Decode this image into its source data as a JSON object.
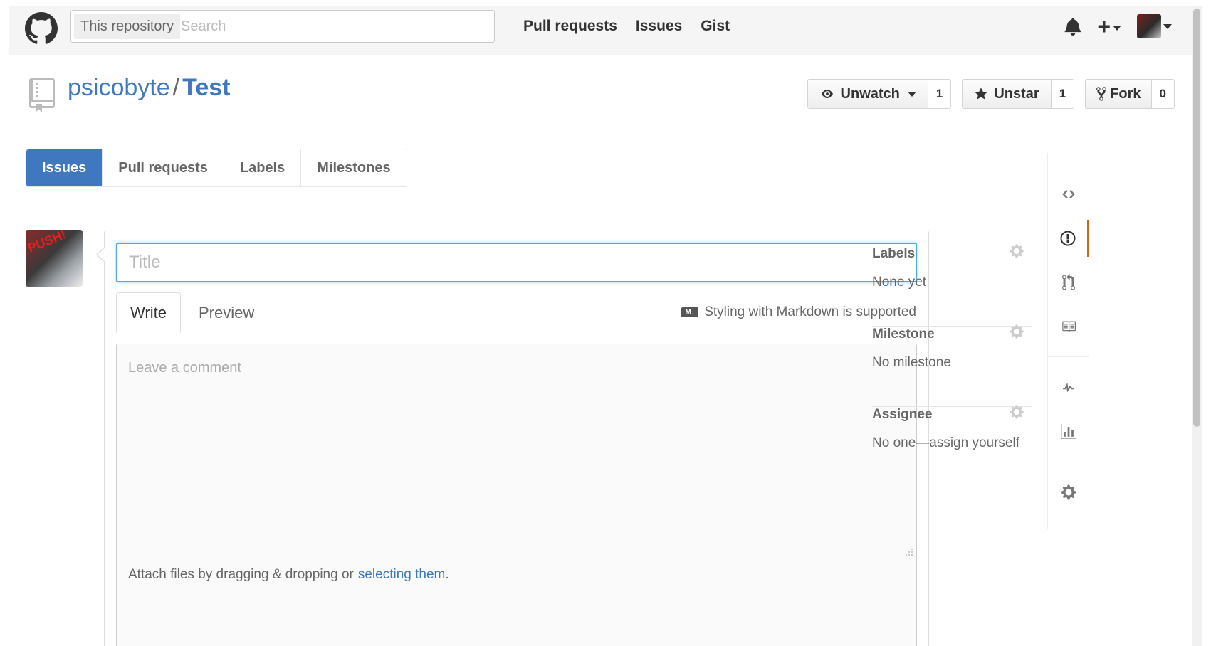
{
  "header": {
    "search_scope": "This repository",
    "search_placeholder": "Search",
    "nav": [
      "Pull requests",
      "Issues",
      "Gist"
    ],
    "plus_label": "+"
  },
  "repo": {
    "owner": "psicobyte",
    "separator": "/",
    "name": "Test",
    "watch": {
      "label": "Unwatch",
      "count": "1"
    },
    "star": {
      "label": "Unstar",
      "count": "1"
    },
    "fork": {
      "label": "Fork",
      "count": "0"
    }
  },
  "subnav": [
    "Issues",
    "Pull requests",
    "Labels",
    "Milestones"
  ],
  "avatar_text": "PUSH!",
  "issue_form": {
    "title_placeholder": "Title",
    "tab_write": "Write",
    "tab_preview": "Preview",
    "md_icon": "M↓",
    "markdown_hint": "Styling with Markdown is supported",
    "comment_placeholder": "Leave a comment",
    "attach_text": "Attach files by dragging & dropping or",
    "attach_link": "selecting them",
    "attach_end": "."
  },
  "sidebar": {
    "labels": {
      "heading": "Labels",
      "value": "None yet"
    },
    "milestone": {
      "heading": "Milestone",
      "value": "No milestone"
    },
    "assignee": {
      "heading": "Assignee",
      "value": "No one—assign yourself"
    }
  },
  "colors": {
    "accent": "#4078c0",
    "focus": "#51a7e8",
    "reponav_active": "#d26911"
  }
}
